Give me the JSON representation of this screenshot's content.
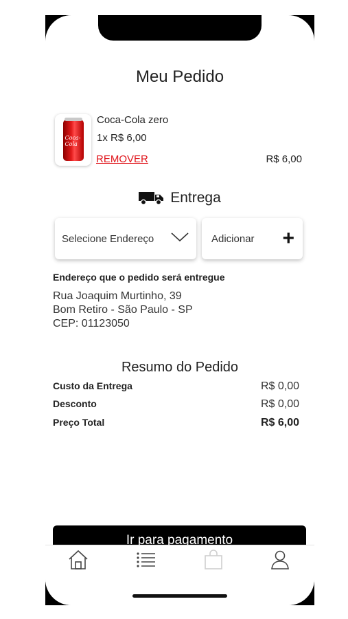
{
  "header": {
    "title": "Meu Pedido"
  },
  "order": {
    "item": {
      "name": "Coca-Cola zero",
      "quantity_price": "1x R$ 6,00",
      "remove_label": "REMOVER",
      "total": "R$ 6,00",
      "image_icon": "coke-can-image"
    }
  },
  "delivery": {
    "heading": "Entrega",
    "icon": "truck-icon",
    "select_address_label": "Selecione Endereço",
    "add_label": "Adicionar",
    "address_heading": "Endereço que o pedido será entregue",
    "address_lines": [
      "Rua Joaquim Murtinho, 39",
      "Bom Retiro - São Paulo - SP",
      "CEP: 01123050"
    ]
  },
  "summary": {
    "title": "Resumo do Pedido",
    "rows": [
      {
        "label": "Custo da Entrega",
        "value": "R$ 0,00"
      },
      {
        "label": "Desconto",
        "value": "R$ 0,00"
      },
      {
        "label": "Preço Total",
        "value": "R$ 6,00"
      }
    ]
  },
  "actions": {
    "pay_label": "Ir para pagamento"
  },
  "tabbar": {
    "items": [
      {
        "icon": "home-icon"
      },
      {
        "icon": "list-icon"
      },
      {
        "icon": "shopping-bag-icon"
      },
      {
        "icon": "user-icon"
      }
    ]
  },
  "colors": {
    "accent_remove": "#e0151b",
    "button_bg": "#000000"
  }
}
